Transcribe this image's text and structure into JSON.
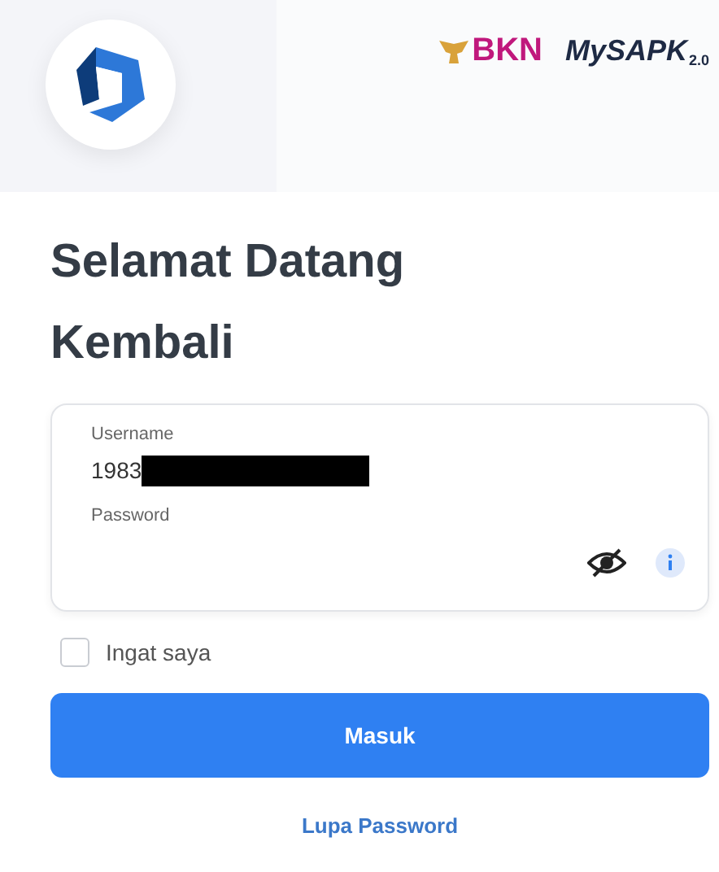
{
  "header": {
    "logos": {
      "bkn": "BKN",
      "mysapk": "MySAPK",
      "version": "2.0"
    }
  },
  "title_lines": [
    "Selamat Datang",
    "Kembali"
  ],
  "form": {
    "username": {
      "label": "Username",
      "value": "1983",
      "redacted": true
    },
    "password": {
      "label": "Password"
    }
  },
  "remember": {
    "label": "Ingat saya",
    "checked": false
  },
  "submit": "Masuk",
  "forgot": "Lupa Password"
}
